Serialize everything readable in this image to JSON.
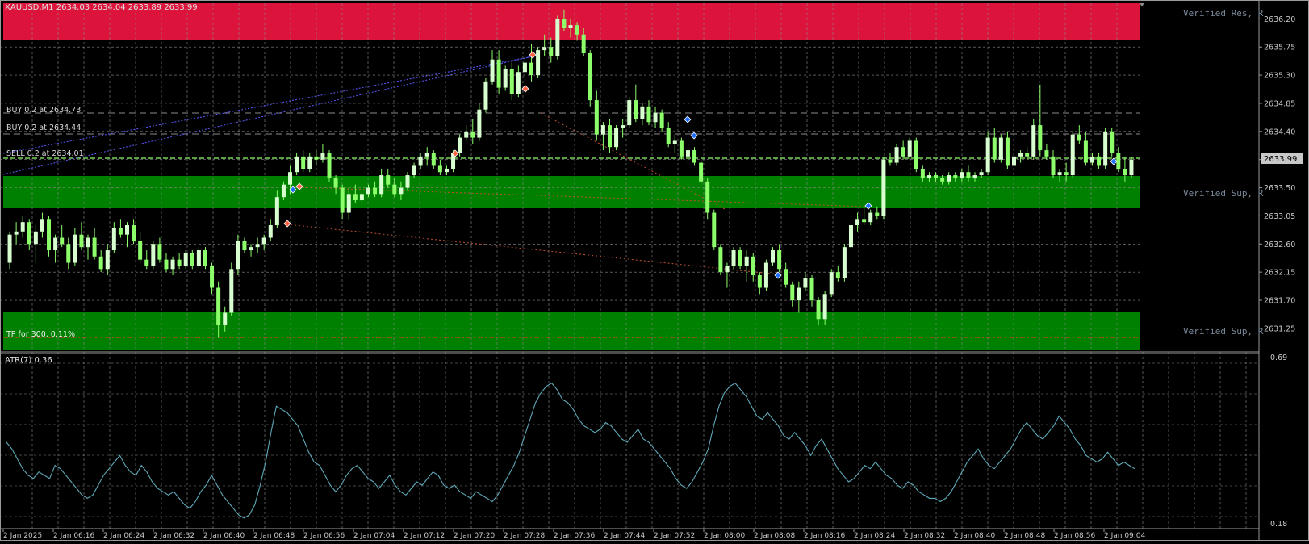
{
  "symbol_header": "XAUUSD,M1  2634.03 2634.04 2633.89 2633.99",
  "colors": {
    "background": "#000000",
    "grid": "#8a8a8a",
    "bull_candle": "#d8ffd0",
    "bear_candle": "#8cff6a",
    "wick": "#8cff6a",
    "resistance_zone": "#dc143c",
    "support_zone": "#008000",
    "atr_line": "#5fa8b8",
    "bid_line": "#8cff6a",
    "trade_line": "#7b7bff",
    "tp_line": "#ff3030",
    "axis_text": "#c8c8c8",
    "zone_label": "#7a8a9a",
    "price_tag_bg": "#c8c8c8"
  },
  "trade_labels": {
    "buy1": "BUY 0.2 at 2634.73",
    "buy2": "BUY 0.2 at 2634.44",
    "sell_overlap": "SELL 0.2 at 2634.01",
    "tp": "TP for 300, 0.11%"
  },
  "zone_labels": {
    "res": "Verified Res, R",
    "sup1": "Verified Sup, R",
    "sup2": "Verified Sup, R"
  },
  "current_price": "2633.99",
  "atr": {
    "label": "ATR(7) 0.36",
    "max": "0.69",
    "min": "0.18"
  },
  "chart_data": {
    "type": "candlestick",
    "title": "XAUUSD,M1",
    "price_ticks": [
      "2636.20",
      "2635.75",
      "2635.30",
      "2634.85",
      "2634.40",
      "2633.95",
      "2633.50",
      "2633.05",
      "2632.60",
      "2632.15",
      "2631.70",
      "2631.25"
    ],
    "time_ticks": [
      "2 Jan 2025",
      "2 Jan 06:16",
      "2 Jan 06:24",
      "2 Jan 06:32",
      "2 Jan 06:40",
      "2 Jan 06:48",
      "2 Jan 06:56",
      "2 Jan 07:04",
      "2 Jan 07:12",
      "2 Jan 07:20",
      "2 Jan 07:28",
      "2 Jan 07:36",
      "2 Jan 07:44",
      "2 Jan 07:52",
      "2 Jan 08:00",
      "2 Jan 08:08",
      "2 Jan 08:16",
      "2 Jan 08:24",
      "2 Jan 08:32",
      "2 Jan 08:40",
      "2 Jan 08:48",
      "2 Jan 08:56",
      "2 Jan 09:04"
    ],
    "ylim": [
      2630.9,
      2636.45
    ],
    "zones": [
      {
        "kind": "resistance",
        "from": 2635.95,
        "to": 2636.5
      },
      {
        "kind": "support",
        "from": 2633.23,
        "to": 2633.72
      },
      {
        "kind": "support",
        "from": 2630.95,
        "to": 2631.58
      }
    ],
    "levels": [
      {
        "name": "BUY 0.2",
        "price": 2634.73
      },
      {
        "name": "BUY 0.2",
        "price": 2634.44
      },
      {
        "name": "SELL 0.2",
        "price": 2634.01
      },
      {
        "name": "TP",
        "price": 2631.05
      }
    ],
    "candles": [
      [
        2632.3,
        2632.8,
        2632.2,
        2632.75
      ],
      [
        2632.75,
        2632.95,
        2632.6,
        2632.8
      ],
      [
        2632.8,
        2633.05,
        2632.7,
        2632.95
      ],
      [
        2632.95,
        2633.0,
        2632.5,
        2632.6
      ],
      [
        2632.6,
        2632.9,
        2632.3,
        2632.8
      ],
      [
        2632.8,
        2633.1,
        2632.7,
        2633.0
      ],
      [
        2633.0,
        2633.05,
        2632.4,
        2632.5
      ],
      [
        2632.5,
        2632.75,
        2632.3,
        2632.7
      ],
      [
        2632.7,
        2632.9,
        2632.55,
        2632.6
      ],
      [
        2632.6,
        2632.7,
        2632.2,
        2632.3
      ],
      [
        2632.3,
        2632.85,
        2632.25,
        2632.75
      ],
      [
        2632.75,
        2632.95,
        2632.5,
        2632.55
      ],
      [
        2632.55,
        2632.75,
        2632.35,
        2632.7
      ],
      [
        2632.7,
        2632.85,
        2632.35,
        2632.4
      ],
      [
        2632.4,
        2632.5,
        2632.15,
        2632.2
      ],
      [
        2632.2,
        2632.6,
        2632.1,
        2632.5
      ],
      [
        2632.5,
        2632.95,
        2632.45,
        2632.85
      ],
      [
        2632.85,
        2633.0,
        2632.7,
        2632.75
      ],
      [
        2632.75,
        2632.95,
        2632.55,
        2632.9
      ],
      [
        2632.9,
        2633.0,
        2632.6,
        2632.65
      ],
      [
        2632.65,
        2632.8,
        2632.3,
        2632.35
      ],
      [
        2632.35,
        2632.5,
        2632.2,
        2632.25
      ],
      [
        2632.25,
        2632.65,
        2632.2,
        2632.6
      ],
      [
        2632.6,
        2632.7,
        2632.3,
        2632.35
      ],
      [
        2632.35,
        2632.45,
        2632.15,
        2632.2
      ],
      [
        2632.2,
        2632.4,
        2632.1,
        2632.35
      ],
      [
        2632.35,
        2632.45,
        2632.2,
        2632.25
      ],
      [
        2632.25,
        2632.5,
        2632.2,
        2632.45
      ],
      [
        2632.45,
        2632.5,
        2632.2,
        2632.25
      ],
      [
        2632.25,
        2632.55,
        2632.2,
        2632.5
      ],
      [
        2632.5,
        2632.55,
        2632.2,
        2632.25
      ],
      [
        2632.25,
        2632.3,
        2631.8,
        2631.9
      ],
      [
        2631.9,
        2632.0,
        2631.1,
        2631.3
      ],
      [
        2631.3,
        2631.6,
        2631.2,
        2631.5
      ],
      [
        2631.5,
        2632.3,
        2631.45,
        2632.2
      ],
      [
        2632.2,
        2632.75,
        2632.1,
        2632.65
      ],
      [
        2632.65,
        2632.7,
        2632.45,
        2632.5
      ],
      [
        2632.5,
        2632.6,
        2632.4,
        2632.55
      ],
      [
        2632.55,
        2632.7,
        2632.45,
        2632.6
      ],
      [
        2632.6,
        2632.75,
        2632.5,
        2632.7
      ],
      [
        2632.7,
        2633.0,
        2632.65,
        2632.9
      ],
      [
        2632.9,
        2633.45,
        2632.85,
        2633.35
      ],
      [
        2633.35,
        2633.6,
        2633.3,
        2633.55
      ],
      [
        2633.55,
        2633.85,
        2633.4,
        2633.75
      ],
      [
        2633.75,
        2634.05,
        2633.7,
        2634.0
      ],
      [
        2634.0,
        2634.1,
        2633.75,
        2633.8
      ],
      [
        2633.8,
        2634.05,
        2633.75,
        2634.0
      ],
      [
        2634.0,
        2634.1,
        2633.85,
        2633.95
      ],
      [
        2633.95,
        2634.2,
        2633.9,
        2634.05
      ],
      [
        2634.05,
        2634.1,
        2633.6,
        2633.65
      ],
      [
        2633.65,
        2633.7,
        2633.4,
        2633.5
      ],
      [
        2633.5,
        2633.55,
        2633.0,
        2633.1
      ],
      [
        2633.1,
        2633.5,
        2633.0,
        2633.4
      ],
      [
        2633.4,
        2633.55,
        2633.25,
        2633.3
      ],
      [
        2633.3,
        2633.45,
        2633.25,
        2633.4
      ],
      [
        2633.4,
        2633.55,
        2633.35,
        2633.5
      ],
      [
        2633.5,
        2633.6,
        2633.35,
        2633.4
      ],
      [
        2633.4,
        2633.8,
        2633.35,
        2633.7
      ],
      [
        2633.7,
        2633.8,
        2633.5,
        2633.55
      ],
      [
        2633.55,
        2633.65,
        2633.35,
        2633.4
      ],
      [
        2633.4,
        2633.6,
        2633.3,
        2633.5
      ],
      [
        2633.5,
        2633.75,
        2633.45,
        2633.7
      ],
      [
        2633.7,
        2633.9,
        2633.65,
        2633.85
      ],
      [
        2633.85,
        2634.05,
        2633.8,
        2634.0
      ],
      [
        2634.0,
        2634.15,
        2633.85,
        2634.05
      ],
      [
        2634.05,
        2634.1,
        2633.8,
        2633.85
      ],
      [
        2633.85,
        2633.95,
        2633.7,
        2633.75
      ],
      [
        2633.75,
        2633.85,
        2633.7,
        2633.8
      ],
      [
        2633.8,
        2634.1,
        2633.75,
        2634.05
      ],
      [
        2634.05,
        2634.35,
        2634.0,
        2634.3
      ],
      [
        2634.3,
        2634.5,
        2634.25,
        2634.4
      ],
      [
        2634.4,
        2634.6,
        2634.2,
        2634.3
      ],
      [
        2634.3,
        2634.85,
        2634.25,
        2634.75
      ],
      [
        2634.75,
        2635.25,
        2634.7,
        2635.2
      ],
      [
        2635.2,
        2635.7,
        2635.15,
        2635.55
      ],
      [
        2635.55,
        2635.7,
        2635.0,
        2635.1
      ],
      [
        2635.1,
        2635.45,
        2635.05,
        2635.4
      ],
      [
        2635.4,
        2635.5,
        2634.9,
        2635.0
      ],
      [
        2635.0,
        2635.45,
        2634.95,
        2635.35
      ],
      [
        2635.35,
        2635.55,
        2635.2,
        2635.5
      ],
      [
        2635.5,
        2635.8,
        2635.2,
        2635.3
      ],
      [
        2635.3,
        2635.75,
        2635.25,
        2635.7
      ],
      [
        2635.7,
        2635.95,
        2635.6,
        2635.75
      ],
      [
        2635.75,
        2635.9,
        2635.5,
        2635.6
      ],
      [
        2635.6,
        2636.25,
        2635.55,
        2636.2
      ],
      [
        2636.2,
        2636.35,
        2636.0,
        2636.05
      ],
      [
        2636.05,
        2636.2,
        2635.9,
        2636.1
      ],
      [
        2636.1,
        2636.15,
        2635.85,
        2635.95
      ],
      [
        2635.95,
        2636.05,
        2635.6,
        2635.65
      ],
      [
        2635.65,
        2635.7,
        2634.8,
        2634.9
      ],
      [
        2634.9,
        2635.05,
        2634.25,
        2634.35
      ],
      [
        2634.35,
        2634.55,
        2634.1,
        2634.5
      ],
      [
        2634.5,
        2634.6,
        2634.05,
        2634.15
      ],
      [
        2634.15,
        2634.5,
        2634.1,
        2634.45
      ],
      [
        2634.45,
        2634.6,
        2634.3,
        2634.5
      ],
      [
        2634.5,
        2634.95,
        2634.45,
        2634.9
      ],
      [
        2634.9,
        2635.15,
        2634.55,
        2634.6
      ],
      [
        2634.6,
        2634.85,
        2634.5,
        2634.8
      ],
      [
        2634.8,
        2634.9,
        2634.5,
        2634.55
      ],
      [
        2634.55,
        2634.8,
        2634.45,
        2634.7
      ],
      [
        2634.7,
        2634.75,
        2634.4,
        2634.45
      ],
      [
        2634.45,
        2634.55,
        2634.15,
        2634.2
      ],
      [
        2634.2,
        2634.35,
        2634.05,
        2634.25
      ],
      [
        2634.25,
        2634.3,
        2633.95,
        2634.0
      ],
      [
        2634.0,
        2634.15,
        2633.9,
        2634.1
      ],
      [
        2634.1,
        2634.15,
        2633.85,
        2633.9
      ],
      [
        2633.9,
        2633.95,
        2633.55,
        2633.6
      ],
      [
        2633.6,
        2633.65,
        2633.0,
        2633.1
      ],
      [
        2633.1,
        2633.15,
        2632.5,
        2632.55
      ],
      [
        2632.55,
        2632.6,
        2632.1,
        2632.15
      ],
      [
        2632.15,
        2632.3,
        2631.9,
        2632.25
      ],
      [
        2632.25,
        2632.55,
        2632.2,
        2632.5
      ],
      [
        2632.5,
        2632.55,
        2632.2,
        2632.25
      ],
      [
        2632.25,
        2632.5,
        2632.0,
        2632.4
      ],
      [
        2632.4,
        2632.45,
        2632.0,
        2632.1
      ],
      [
        2632.1,
        2632.15,
        2631.8,
        2631.9
      ],
      [
        2631.9,
        2632.35,
        2631.85,
        2632.3
      ],
      [
        2632.3,
        2632.55,
        2632.25,
        2632.5
      ],
      [
        2632.5,
        2632.6,
        2632.15,
        2632.2
      ],
      [
        2632.2,
        2632.3,
        2631.9,
        2631.95
      ],
      [
        2631.95,
        2632.0,
        2631.6,
        2631.7
      ],
      [
        2631.7,
        2632.0,
        2631.5,
        2631.9
      ],
      [
        2631.9,
        2632.15,
        2631.85,
        2632.05
      ],
      [
        2632.05,
        2632.1,
        2631.6,
        2631.7
      ],
      [
        2631.7,
        2631.75,
        2631.3,
        2631.4
      ],
      [
        2631.4,
        2631.85,
        2631.3,
        2631.8
      ],
      [
        2631.8,
        2632.2,
        2631.75,
        2632.15
      ],
      [
        2632.15,
        2632.25,
        2632.0,
        2632.05
      ],
      [
        2632.05,
        2632.6,
        2632.0,
        2632.55
      ],
      [
        2632.55,
        2632.95,
        2632.5,
        2632.9
      ],
      [
        2632.9,
        2633.1,
        2632.8,
        2633.0
      ],
      [
        2633.0,
        2633.2,
        2632.9,
        2632.95
      ],
      [
        2632.95,
        2633.15,
        2632.9,
        2633.1
      ],
      [
        2633.1,
        2633.2,
        2633.0,
        2633.05
      ],
      [
        2633.05,
        2634.0,
        2633.0,
        2633.95
      ],
      [
        2633.95,
        2634.05,
        2633.85,
        2633.9
      ],
      [
        2633.9,
        2634.2,
        2633.85,
        2634.15
      ],
      [
        2634.15,
        2634.25,
        2633.95,
        2634.0
      ],
      [
        2634.0,
        2634.3,
        2633.95,
        2634.25
      ],
      [
        2634.25,
        2634.3,
        2633.75,
        2633.8
      ],
      [
        2633.8,
        2633.85,
        2633.6,
        2633.65
      ],
      [
        2633.65,
        2633.75,
        2633.6,
        2633.7
      ],
      [
        2633.7,
        2633.75,
        2633.6,
        2633.65
      ],
      [
        2633.65,
        2633.7,
        2633.55,
        2633.6
      ],
      [
        2633.6,
        2633.75,
        2633.55,
        2633.7
      ],
      [
        2633.7,
        2633.75,
        2633.6,
        2633.65
      ],
      [
        2633.65,
        2633.8,
        2633.6,
        2633.75
      ],
      [
        2633.75,
        2633.85,
        2633.6,
        2633.65
      ],
      [
        2633.65,
        2633.75,
        2633.6,
        2633.7
      ],
      [
        2633.7,
        2633.8,
        2633.65,
        2633.75
      ],
      [
        2633.75,
        2634.4,
        2633.7,
        2634.3
      ],
      [
        2634.3,
        2634.45,
        2633.9,
        2633.95
      ],
      [
        2633.95,
        2634.35,
        2633.9,
        2634.3
      ],
      [
        2634.3,
        2634.4,
        2633.8,
        2633.85
      ],
      [
        2633.85,
        2634.05,
        2633.8,
        2634.0
      ],
      [
        2634.0,
        2634.1,
        2633.9,
        2634.05
      ],
      [
        2634.05,
        2634.15,
        2633.95,
        2634.0
      ],
      [
        2634.0,
        2634.6,
        2633.95,
        2634.5
      ],
      [
        2634.5,
        2635.15,
        2634.0,
        2634.1
      ],
      [
        2634.1,
        2634.2,
        2633.95,
        2634.0
      ],
      [
        2634.0,
        2634.1,
        2633.65,
        2633.7
      ],
      [
        2633.7,
        2633.8,
        2633.6,
        2633.75
      ],
      [
        2633.75,
        2633.9,
        2633.6,
        2633.7
      ],
      [
        2633.7,
        2634.4,
        2633.65,
        2634.35
      ],
      [
        2634.35,
        2634.5,
        2634.2,
        2634.25
      ],
      [
        2634.25,
        2634.4,
        2633.85,
        2633.9
      ],
      [
        2633.9,
        2634.05,
        2633.85,
        2634.0
      ],
      [
        2634.0,
        2634.05,
        2633.8,
        2633.85
      ],
      [
        2633.85,
        2634.45,
        2633.8,
        2634.4
      ],
      [
        2634.4,
        2634.45,
        2634.0,
        2634.05
      ],
      [
        2634.05,
        2634.15,
        2633.75,
        2633.8
      ],
      [
        2633.8,
        2634.0,
        2633.6,
        2633.7
      ],
      [
        2633.7,
        2634.0,
        2633.65,
        2633.95
      ]
    ],
    "atr_values": [
      0.43,
      0.41,
      0.38,
      0.35,
      0.33,
      0.32,
      0.34,
      0.33,
      0.32,
      0.36,
      0.35,
      0.33,
      0.31,
      0.29,
      0.27,
      0.26,
      0.27,
      0.3,
      0.33,
      0.35,
      0.37,
      0.39,
      0.36,
      0.34,
      0.33,
      0.36,
      0.34,
      0.31,
      0.29,
      0.28,
      0.27,
      0.28,
      0.26,
      0.24,
      0.23,
      0.25,
      0.28,
      0.3,
      0.33,
      0.3,
      0.27,
      0.25,
      0.23,
      0.21,
      0.2,
      0.21,
      0.24,
      0.3,
      0.37,
      0.46,
      0.54,
      0.53,
      0.52,
      0.5,
      0.48,
      0.44,
      0.4,
      0.37,
      0.36,
      0.33,
      0.3,
      0.28,
      0.3,
      0.33,
      0.35,
      0.36,
      0.34,
      0.32,
      0.31,
      0.29,
      0.31,
      0.33,
      0.3,
      0.28,
      0.27,
      0.29,
      0.31,
      0.3,
      0.32,
      0.34,
      0.33,
      0.3,
      0.29,
      0.3,
      0.28,
      0.27,
      0.26,
      0.28,
      0.27,
      0.26,
      0.25,
      0.27,
      0.3,
      0.33,
      0.36,
      0.4,
      0.45,
      0.5,
      0.55,
      0.58,
      0.6,
      0.61,
      0.59,
      0.56,
      0.55,
      0.53,
      0.5,
      0.48,
      0.47,
      0.46,
      0.47,
      0.49,
      0.48,
      0.46,
      0.44,
      0.43,
      0.45,
      0.47,
      0.44,
      0.43,
      0.41,
      0.39,
      0.37,
      0.35,
      0.32,
      0.3,
      0.29,
      0.31,
      0.34,
      0.37,
      0.41,
      0.48,
      0.54,
      0.58,
      0.6,
      0.61,
      0.59,
      0.57,
      0.54,
      0.51,
      0.5,
      0.52,
      0.5,
      0.48,
      0.45,
      0.44,
      0.46,
      0.44,
      0.42,
      0.39,
      0.42,
      0.44,
      0.41,
      0.38,
      0.35,
      0.33,
      0.31,
      0.32,
      0.34,
      0.36,
      0.35,
      0.37,
      0.35,
      0.33,
      0.32,
      0.3,
      0.29,
      0.31,
      0.3,
      0.28,
      0.27,
      0.26,
      0.26,
      0.25,
      0.26,
      0.28,
      0.31,
      0.34,
      0.37,
      0.39,
      0.41,
      0.38,
      0.36,
      0.35,
      0.37,
      0.39,
      0.41,
      0.44,
      0.47,
      0.49,
      0.47,
      0.45,
      0.44,
      0.46,
      0.48,
      0.51,
      0.49,
      0.47,
      0.44,
      0.42,
      0.39,
      0.38,
      0.37,
      0.38,
      0.4,
      0.38,
      0.36,
      0.37,
      0.36,
      0.35
    ]
  }
}
